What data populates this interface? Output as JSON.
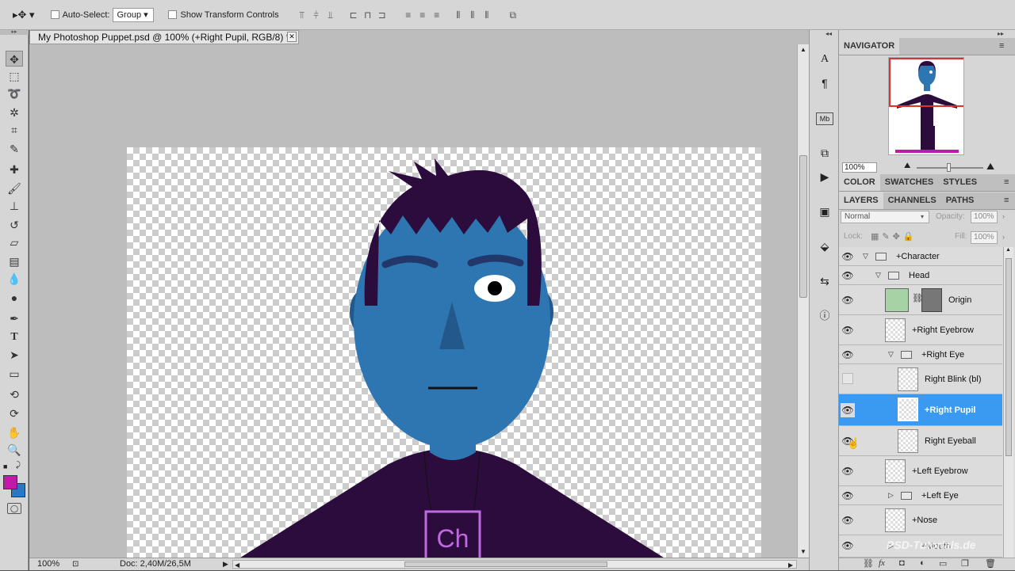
{
  "options_bar": {
    "auto_select_label": "Auto-Select:",
    "auto_select_value": "Group",
    "show_transform_label": "Show Transform Controls"
  },
  "document": {
    "tab_title": "My Photoshop Puppet.psd @ 100% (+Right Pupil, RGB/8) *",
    "close_glyph": "✕",
    "zoom": "100%",
    "doc_size": "Doc: 2,40M/26,5M",
    "shirt_logo": "Ch"
  },
  "colors": {
    "foreground": "#c21aa8",
    "background": "#2a77c4",
    "skin": "#2e76b2",
    "hair": "#2c0c3c",
    "selection": "#3a9af2"
  },
  "navigator": {
    "tab": "NAVIGATOR",
    "zoom": "100%"
  },
  "color_tabs": [
    "COLOR",
    "SWATCHES",
    "STYLES"
  ],
  "layer_tabs": [
    "LAYERS",
    "CHANNELS",
    "PATHS"
  ],
  "layers_panel": {
    "blend_mode": "Normal",
    "opacity_label": "Opacity:",
    "opacity_value": "100%",
    "lock_label": "Lock:",
    "fill_label": "Fill:",
    "fill_value": "100%",
    "layers": [
      {
        "name": "+Character"
      },
      {
        "name": "Head"
      },
      {
        "name": "Origin"
      },
      {
        "name": "+Right Eyebrow"
      },
      {
        "name": "+Right Eye"
      },
      {
        "name": "Right Blink (bl)"
      },
      {
        "name": "+Right Pupil"
      },
      {
        "name": "Right Eyeball"
      },
      {
        "name": "+Left Eyebrow"
      },
      {
        "name": "+Left Eye"
      },
      {
        "name": "+Nose"
      },
      {
        "name": "+Mouth"
      }
    ]
  },
  "watermark": "PSD-Tutorials.de"
}
